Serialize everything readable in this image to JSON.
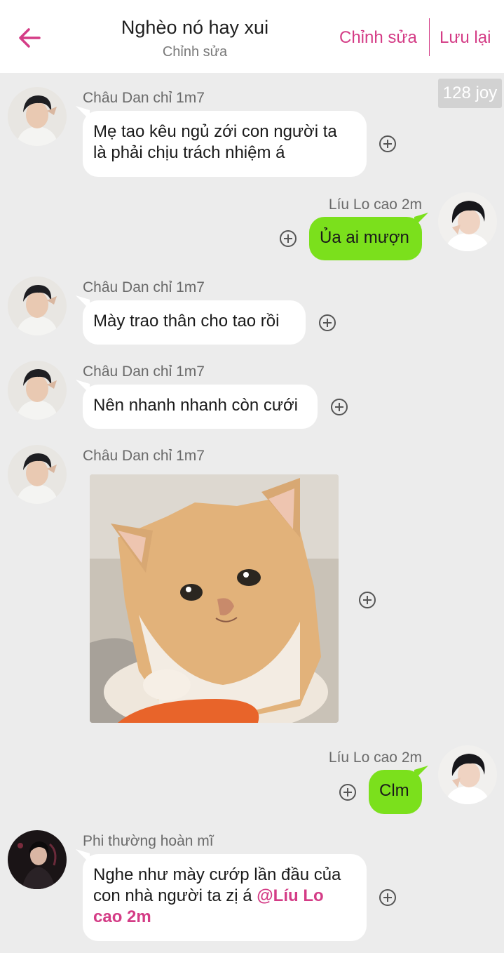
{
  "header": {
    "title": "Nghèo nó hay xui",
    "subtitle": "Chỉnh sửa",
    "edit_label": "Chỉnh sửa",
    "save_label": "Lưu lại"
  },
  "joy_badge": "128 joy",
  "messages": [
    {
      "sender": "Châu Dan chỉ 1m7",
      "direction": "incoming",
      "text": "Mẹ tao kêu ngủ zới con người ta\nlà phải chịu trách nhiệm á"
    },
    {
      "sender": "Líu Lo cao 2m",
      "direction": "outgoing",
      "text": "Ủa ai mượn"
    },
    {
      "sender": "Châu Dan chỉ 1m7",
      "direction": "incoming",
      "text": "Mày trao thân cho tao rồi"
    },
    {
      "sender": "Châu Dan chỉ 1m7",
      "direction": "incoming",
      "text": "Nên nhanh nhanh còn cưới"
    },
    {
      "sender": "Châu Dan chỉ 1m7",
      "direction": "incoming",
      "image": "kitten-photo"
    },
    {
      "sender": "Líu Lo cao 2m",
      "direction": "outgoing",
      "text": "Clm"
    },
    {
      "sender": "Phi thường hoàn mĩ",
      "direction": "incoming",
      "text": "Nghe như mày cướp lần đầu của\ncon nhà người ta zị á ",
      "mention": "@Líu Lo\ncao 2m"
    }
  ],
  "colors": {
    "accent": "#d43c86",
    "outgoing_bubble": "#7be01c",
    "incoming_bubble": "#ffffff",
    "background": "#ececec"
  },
  "icons": [
    "back-arrow-icon",
    "add-reaction-icon"
  ]
}
